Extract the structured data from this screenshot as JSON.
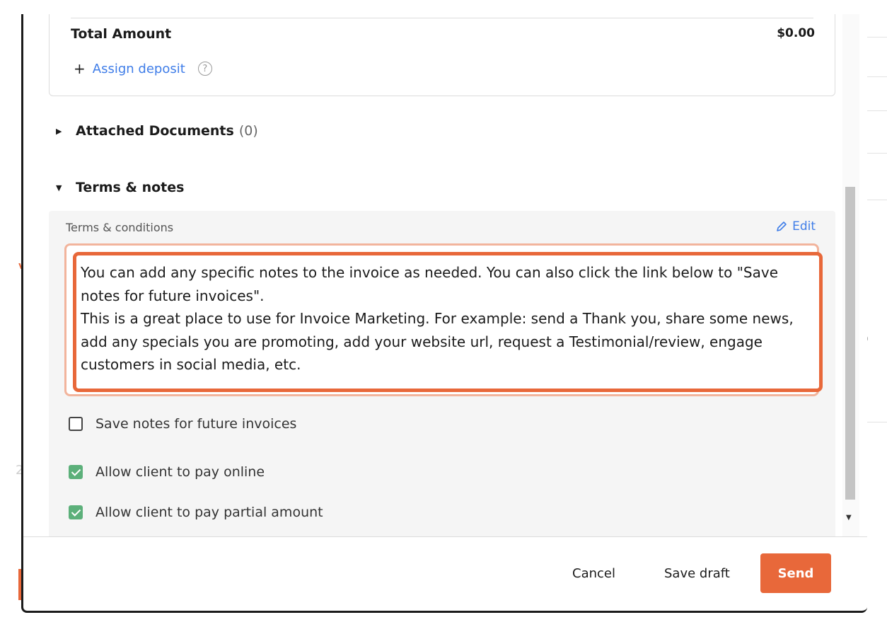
{
  "totals": {
    "total_label": "Total Amount",
    "total_value": "$0.00",
    "assign_deposit_label": "Assign deposit",
    "help_icon": "question-circle-icon"
  },
  "attached_documents": {
    "title": "Attached Documents",
    "count": "(0)"
  },
  "terms_section": {
    "title": "Terms & notes",
    "terms_label": "Terms & conditions",
    "edit_label": "Edit",
    "notes_text": "You can add any specific notes to the invoice as needed. You can also click the link below to \"Save notes for future invoices\".\nThis is a great place to use for Invoice Marketing. For example: send a Thank you, share some news, add any specials you are promoting, add your website url, request a Testimonial/review, engage customers in social media, etc."
  },
  "options": [
    {
      "label": "Save notes for future invoices",
      "checked": false
    },
    {
      "label": "Allow client to pay online",
      "checked": true
    },
    {
      "label": "Allow client to pay partial amount",
      "checked": true
    }
  ],
  "footer": {
    "cancel_label": "Cancel",
    "save_draft_label": "Save draft",
    "send_label": "Send"
  },
  "background": {
    "left_button_text": "er",
    "left_accent_text": "v",
    "left_number_text": "2",
    "right_fragments": [
      "e",
      "E",
      "h",
      "D",
      "C"
    ]
  },
  "colors": {
    "accent": "#e8683a",
    "link": "#3f7de8",
    "check": "#5cb07a",
    "panel": "#f5f5f5"
  }
}
